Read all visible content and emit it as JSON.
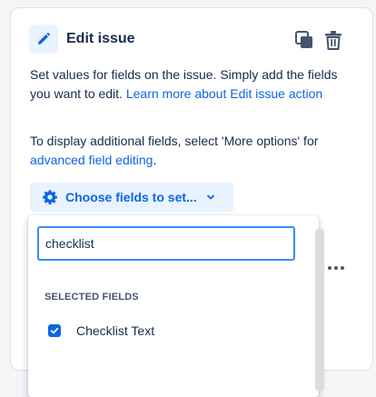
{
  "header": {
    "title": "Edit issue",
    "icons": {
      "badge": "pencil-icon",
      "copy": "copy-icon",
      "delete": "trash-icon"
    }
  },
  "description": {
    "line1_text": "Set values for fields on the issue. Simply add the fields you want to edit. ",
    "line1_link": "Learn more about Edit issue action",
    "line2_text": "To display additional fields, select 'More options' for ",
    "line2_link": "advanced field editing",
    "line2_end": "."
  },
  "choose_fields": {
    "label": "Choose fields to set...",
    "icon": "gear-icon",
    "chevron": "chevron-down-icon"
  },
  "dropdown": {
    "search_value": "checklist",
    "section_label": "SELECTED FIELDS",
    "options": [
      {
        "label": "Checklist Text",
        "checked": true
      }
    ]
  },
  "colors": {
    "accent": "#0c66e4",
    "accent_bg": "#e9f2ff",
    "focus": "#388bff",
    "text": "#172b4d"
  }
}
